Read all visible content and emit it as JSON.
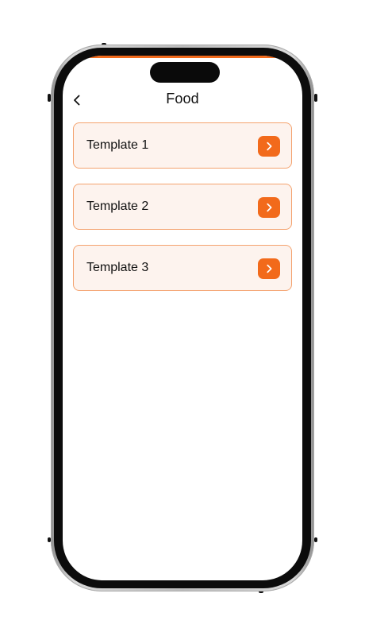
{
  "colors": {
    "accent": "#f26a1b",
    "card_bg": "#fdf3ee",
    "card_border": "#f4a36f",
    "text": "#111111"
  },
  "header": {
    "title": "Food",
    "back_icon": "chevron-left-icon"
  },
  "templates": [
    {
      "label": "Template 1",
      "icon": "chevron-right-icon"
    },
    {
      "label": "Template 2",
      "icon": "chevron-right-icon"
    },
    {
      "label": "Template 3",
      "icon": "chevron-right-icon"
    }
  ]
}
